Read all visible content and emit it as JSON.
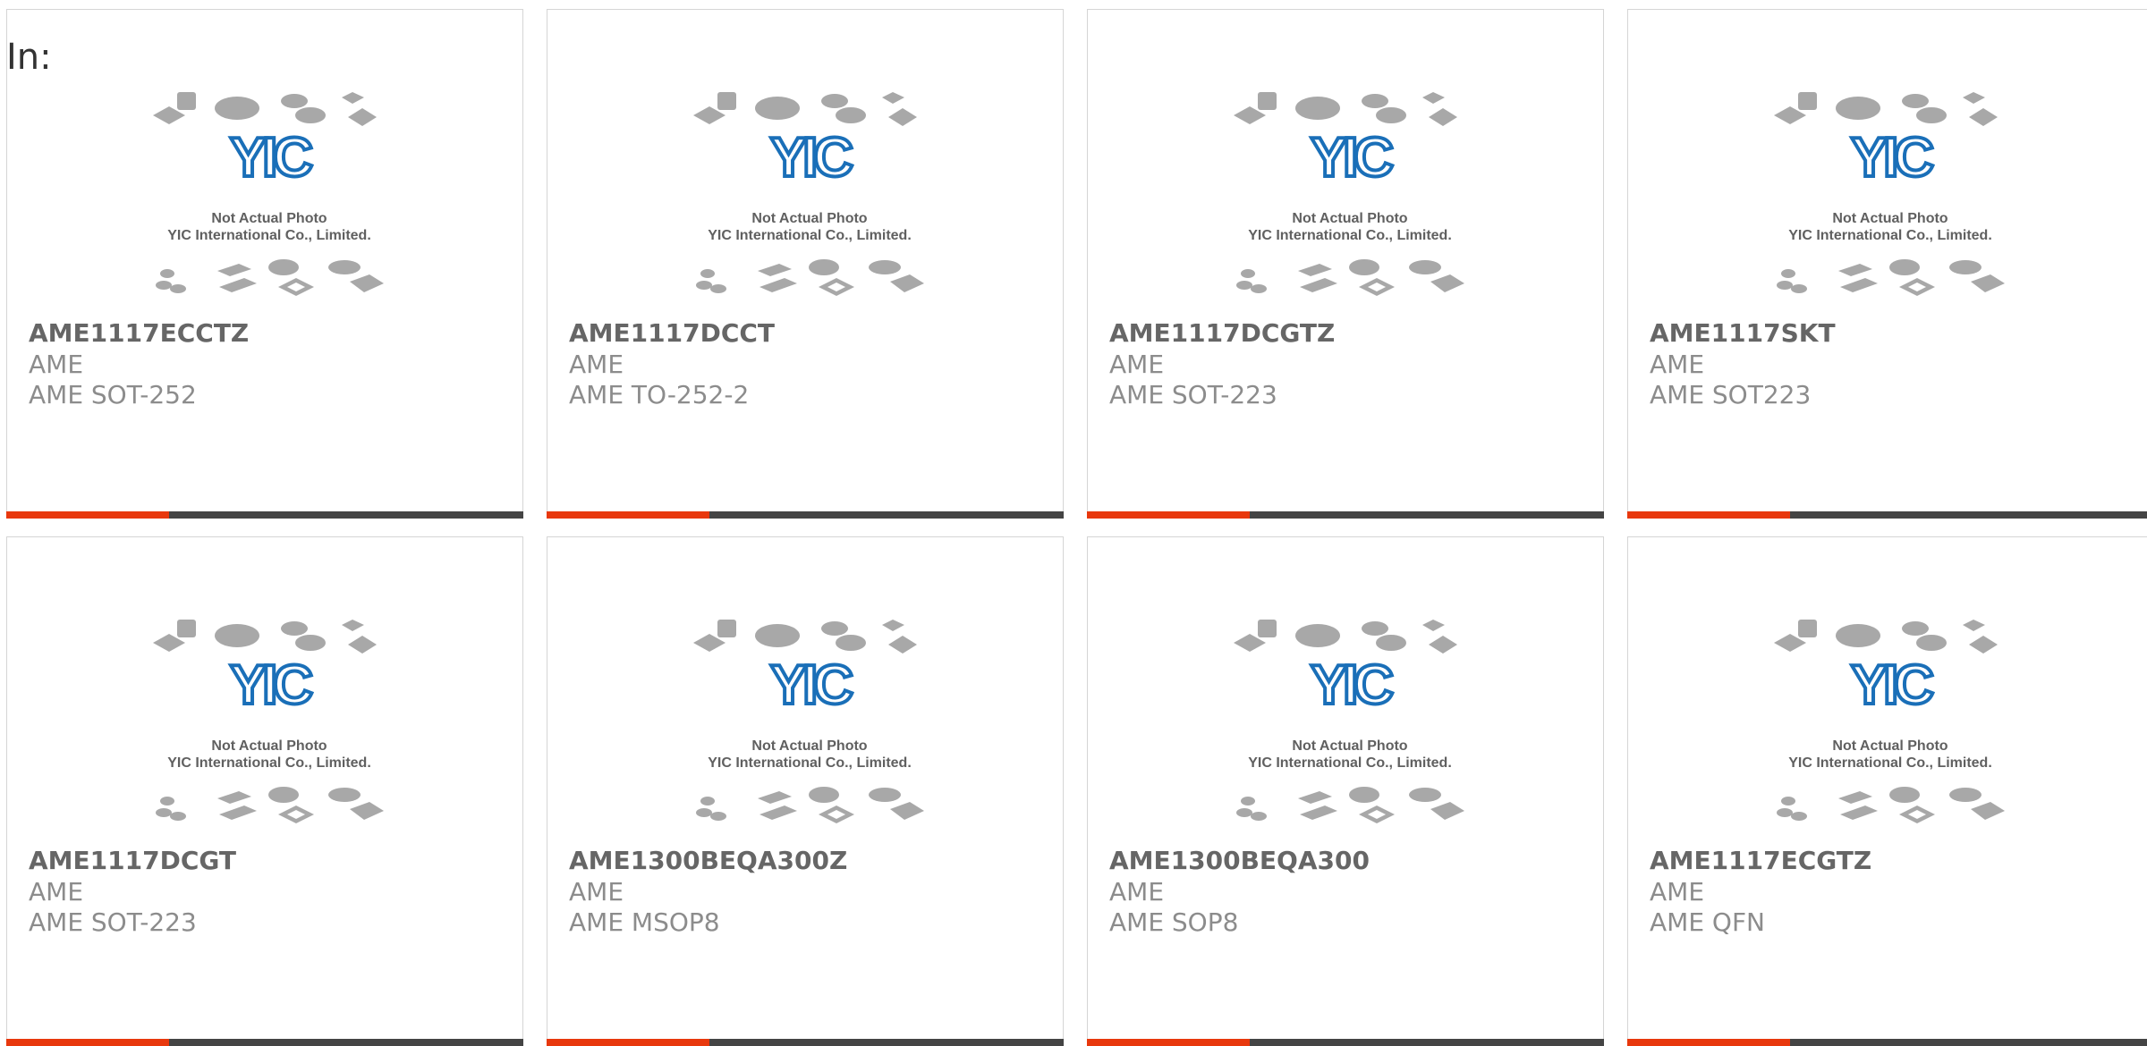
{
  "filter": {
    "label": "In:"
  },
  "placeholder_image": {
    "logo_text": "YIC",
    "caption_line1": "Not Actual Photo",
    "caption_line2": "YIC International Co., Limited."
  },
  "colors": {
    "accent": "#e8380d",
    "bar": "#444444",
    "logo_blue": "#1a6fb8",
    "chip_gray": "#a8a8a8",
    "part_text": "#666666",
    "meta_text": "#8c8c8c"
  },
  "products": [
    {
      "part": "AME1117ECCTZ",
      "manufacturer": "AME",
      "package": "AME SOT-252"
    },
    {
      "part": "AME1117DCCT",
      "manufacturer": "AME",
      "package": "AME TO-252-2"
    },
    {
      "part": "AME1117DCGTZ",
      "manufacturer": "AME",
      "package": "AME SOT-223"
    },
    {
      "part": "AME1117SKT",
      "manufacturer": "AME",
      "package": "AME SOT223"
    },
    {
      "part": "AME1117DCGT",
      "manufacturer": "AME",
      "package": "AME SOT-223"
    },
    {
      "part": "AME1300BEQA300Z",
      "manufacturer": "AME",
      "package": "AME MSOP8"
    },
    {
      "part": "AME1300BEQA300",
      "manufacturer": "AME",
      "package": "AME SOP8"
    },
    {
      "part": "AME1117ECGTZ",
      "manufacturer": "AME",
      "package": "AME QFN"
    }
  ]
}
